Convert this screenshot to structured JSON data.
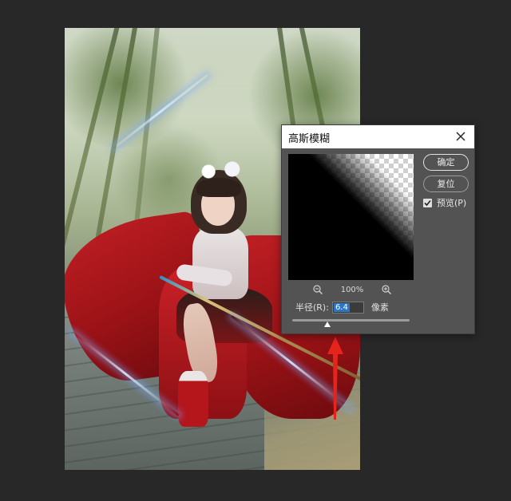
{
  "dialog": {
    "title": "高斯模糊",
    "ok_label": "确定",
    "reset_label": "复位",
    "preview_label": "预览(P)",
    "preview_checked": true,
    "zoom_level": "100%",
    "radius_label": "半径(R):",
    "radius_value": "6.4",
    "unit_label": "像素",
    "slider_fraction": 0.3
  },
  "icons": {
    "close": "close-icon",
    "zoom_out": "zoom-out-icon",
    "zoom_in": "zoom-in-icon",
    "checkmark": "checkmark-icon"
  },
  "colors": {
    "workspace_bg": "#282828",
    "dialog_bg": "#535353",
    "selection_blue": "#2c76c6",
    "annotation_red": "#e5241c"
  }
}
